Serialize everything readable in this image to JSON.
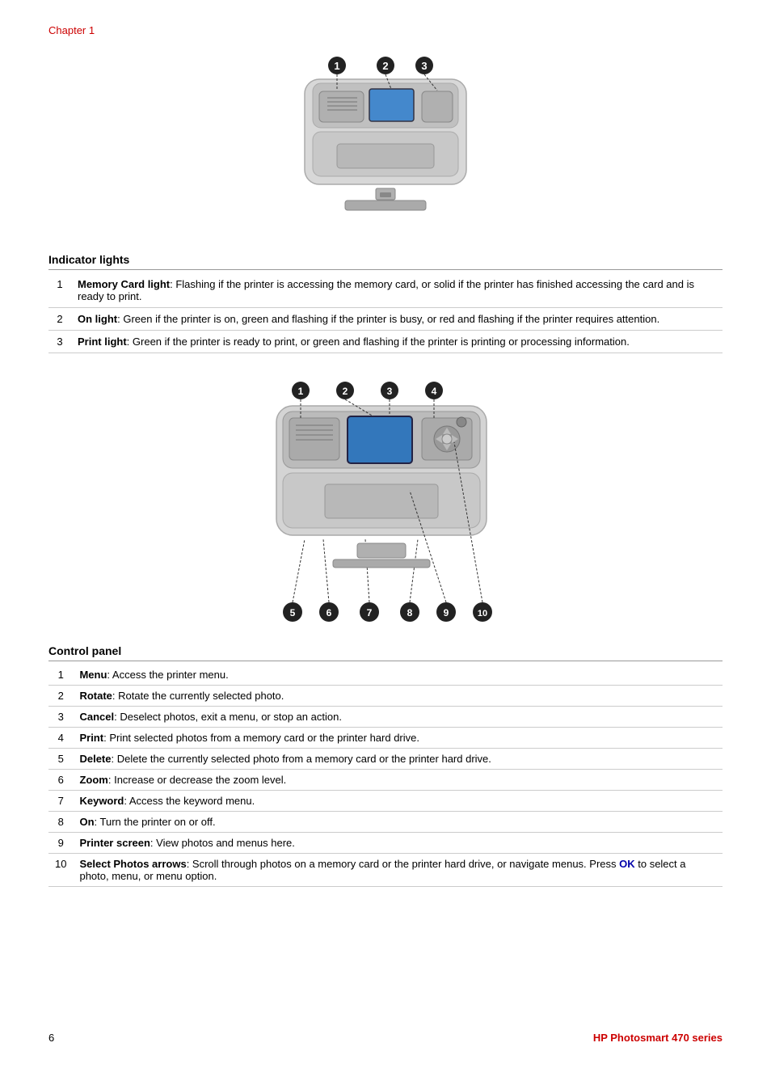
{
  "chapter_label": "Chapter 1",
  "section1": {
    "title": "Indicator lights",
    "rows": [
      {
        "num": 1,
        "label": "Memory Card light",
        "desc": ": Flashing if the printer is accessing the memory card, or solid if the printer has finished accessing the card and is ready to print."
      },
      {
        "num": 2,
        "label": "On light",
        "desc": ": Green if the printer is on, green and flashing if the printer is busy, or red and flashing if the printer requires attention."
      },
      {
        "num": 3,
        "label": "Print light",
        "desc": ": Green if the printer is ready to print, or green and flashing if the printer is printing or processing information."
      }
    ]
  },
  "section2": {
    "title": "Control panel",
    "rows": [
      {
        "num": 1,
        "label": "Menu",
        "desc": ": Access the printer menu."
      },
      {
        "num": 2,
        "label": "Rotate",
        "desc": ": Rotate the currently selected photo."
      },
      {
        "num": 3,
        "label": "Cancel",
        "desc": ": Deselect photos, exit a menu, or stop an action."
      },
      {
        "num": 4,
        "label": "Print",
        "desc": ": Print selected photos from a memory card or the printer hard drive."
      },
      {
        "num": 5,
        "label": "Delete",
        "desc": ": Delete the currently selected photo from a memory card or the printer hard drive."
      },
      {
        "num": 6,
        "label": "Zoom",
        "desc": ": Increase or decrease the zoom level."
      },
      {
        "num": 7,
        "label": "Keyword",
        "desc": ": Access the keyword menu."
      },
      {
        "num": 8,
        "label": "On",
        "desc": ": Turn the printer on or off."
      },
      {
        "num": 9,
        "label": "Printer screen",
        "desc": ": View photos and menus here."
      },
      {
        "num": 10,
        "label": "Select Photos arrows",
        "desc": ": Scroll through photos on a memory card or the printer hard drive, or navigate menus. Press ",
        "ok": "OK",
        "desc2": " to select a photo, menu, or menu option."
      }
    ]
  },
  "footer": {
    "page": "6",
    "product": "HP Photosmart 470 series"
  }
}
